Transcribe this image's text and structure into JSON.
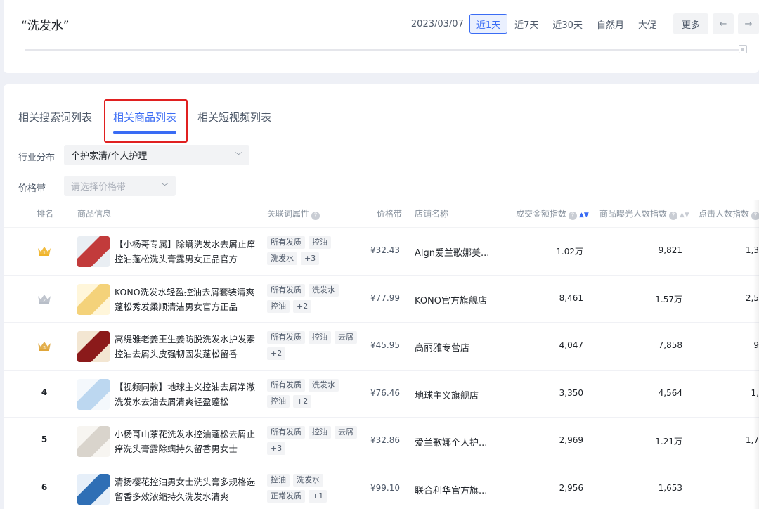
{
  "keyword": "“洗发水”",
  "date": "2023/03/07",
  "ranges": [
    "近1天",
    "近7天",
    "近30天",
    "自然月",
    "大促"
  ],
  "more_label": "更多",
  "prev_icon": "←",
  "next_icon": "→",
  "tabs": [
    "相关搜索词列表",
    "相关商品列表",
    "相关短视频列表"
  ],
  "filters": {
    "industry_label": "行业分布",
    "industry_value": "个护家清/个人护理",
    "price_label": "价格带",
    "price_placeholder": "请选择价格带"
  },
  "columns": {
    "rank": "排名",
    "product": "商品信息",
    "attr": "关联词属性",
    "price": "价格带",
    "shop": "店铺名称",
    "gmv": "成交金额指数",
    "exposure": "商品曝光人数指数",
    "click": "点击人数指数"
  },
  "colors": {
    "accent": "#3a6cf4",
    "highlight": "#e02020",
    "gold": "#f0b429",
    "silver": "#b8bec8"
  },
  "rows": [
    {
      "rank": "1",
      "medal": "gold",
      "title": "【小杨哥专属】除螨洗发水去屑止痒控油蓬松洗头膏露男女正品官方",
      "tags": [
        "所有发质",
        "控油",
        "洗发水",
        "+3"
      ],
      "price": "¥32.43",
      "shop": "Algn爱兰歌娜美...",
      "gmv": "1.02万",
      "exposure": "9,821",
      "click": "1,3"
    },
    {
      "rank": "2",
      "medal": "silver",
      "title": "KONO洗发水轻盈控油去屑套装清爽蓬松秀发柔顺清洁男女官方正品",
      "tags": [
        "所有发质",
        "洗发水",
        "控油",
        "+2"
      ],
      "price": "¥77.99",
      "shop": "KONO官方旗舰店",
      "gmv": "8,461",
      "exposure": "1.57万",
      "click": "2,5"
    },
    {
      "rank": "3",
      "medal": "bronze",
      "title": "高缇雅老姜王生姜防脱洗发水护发素控油去屑头皮强韧固发蓬松留香",
      "tags": [
        "所有发质",
        "控油",
        "去屑",
        "+2"
      ],
      "price": "¥45.95",
      "shop": "高丽雅专营店",
      "gmv": "4,047",
      "exposure": "7,858",
      "click": "9"
    },
    {
      "rank": "4",
      "medal": "",
      "title": "【视频同款】地球主义控油去屑净澈洗发水去油去屑清爽轻盈蓬松",
      "tags": [
        "所有发质",
        "洗发水",
        "控油",
        "+2"
      ],
      "price": "¥76.46",
      "shop": "地球主义旗舰店",
      "gmv": "3,350",
      "exposure": "4,564",
      "click": "1,"
    },
    {
      "rank": "5",
      "medal": "",
      "title": "小杨哥山茶花洗发水控油蓬松去屑止痒洗头膏露除螨持久留香男女士",
      "tags": [
        "所有发质",
        "控油",
        "去屑",
        "+3"
      ],
      "price": "¥32.86",
      "shop": "爱兰歌娜个人护...",
      "gmv": "2,969",
      "exposure": "1.21万",
      "click": "1,7"
    },
    {
      "rank": "6",
      "medal": "",
      "title": "清扬樱花控油男女士洗头膏多规格选留香多效浓缩持久洗发水清爽",
      "tags": [
        "控油",
        "洗发水",
        "正常发质",
        "+1"
      ],
      "price": "¥99.10",
      "shop": "联合利华官方旗...",
      "gmv": "2,956",
      "exposure": "1,653",
      "click": ""
    }
  ]
}
